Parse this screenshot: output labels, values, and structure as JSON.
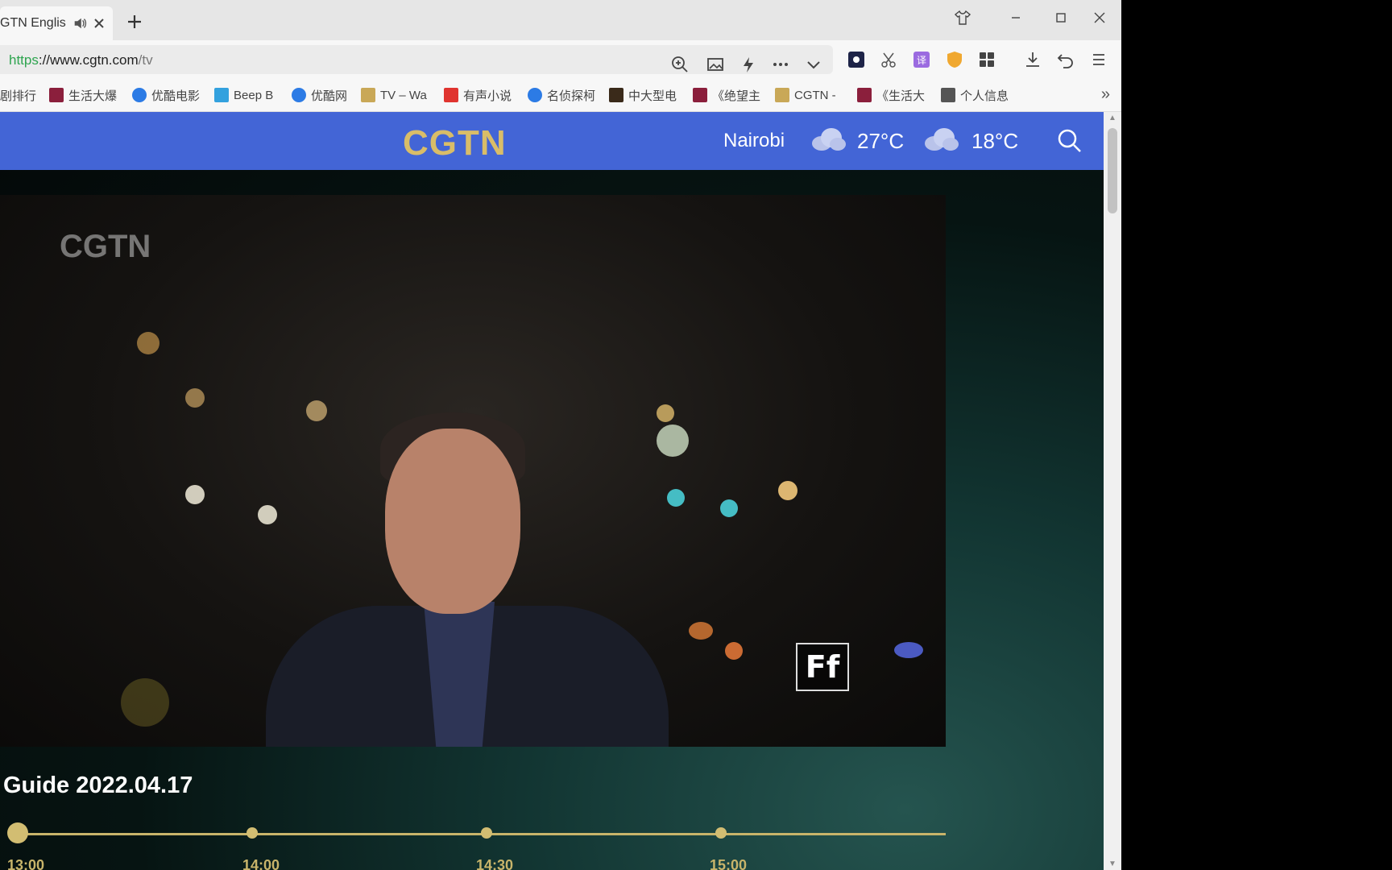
{
  "browser": {
    "tab": {
      "title": "GTN English"
    },
    "address": {
      "scheme": "https",
      "sep": "://",
      "host": "www.cgtn.com",
      "path": "/tv"
    },
    "bookmarks": [
      {
        "label": "剧排行",
        "color": "#f7f7f7"
      },
      {
        "label": "生活大爆",
        "color": "#8b1f3c"
      },
      {
        "label": "优酷电影",
        "color": "#2c7be5"
      },
      {
        "label": "Beep B",
        "color": "#33a1de"
      },
      {
        "label": "优酷网",
        "color": "#2c7be5"
      },
      {
        "label": "TV – Wa",
        "color": "#c9a857"
      },
      {
        "label": "有声小说",
        "color": "#e0342f"
      },
      {
        "label": "名侦探柯",
        "color": "#2c7be5"
      },
      {
        "label": "中大型电",
        "color": "#3a2a1a"
      },
      {
        "label": "《绝望主",
        "color": "#8b1f3c"
      },
      {
        "label": "CGTN -",
        "color": "#c9a857"
      },
      {
        "label": "《生活大",
        "color": "#8b1f3c"
      },
      {
        "label": "个人信息",
        "color": "#555555"
      }
    ],
    "bookmarks_more": "»"
  },
  "site": {
    "logo": "CGTN",
    "city": "Nairobi",
    "temp_high": "27°C",
    "temp_low": "18°C"
  },
  "video": {
    "watermark": "CGTN",
    "corner_logo": "Ff"
  },
  "guide": {
    "title": "Guide 2022.04.17",
    "times": [
      "13:00",
      "14:00",
      "14:30",
      "15:00"
    ]
  },
  "colors": {
    "header_blue": "#4365d6",
    "gold": "#d9bd68"
  }
}
